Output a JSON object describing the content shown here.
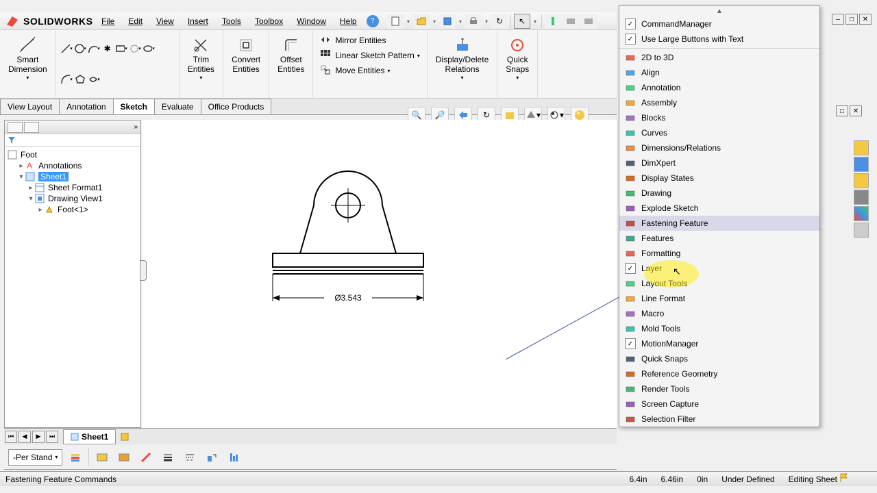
{
  "app": {
    "name": "SOLIDWORKS"
  },
  "menu": [
    "File",
    "Edit",
    "View",
    "Insert",
    "Tools",
    "Toolbox",
    "Window",
    "Help"
  ],
  "ribbon": {
    "smart_dimension": "Smart\nDimension",
    "trim_entities": "Trim\nEntities",
    "convert_entities": "Convert\nEntities",
    "offset_entities": "Offset\nEntities",
    "mirror_entities": "Mirror Entities",
    "linear_pattern": "Linear Sketch Pattern",
    "move_entities": "Move Entities",
    "display_relations": "Display/Delete\nRelations",
    "quick_snaps": "Quick\nSnaps"
  },
  "tabs": [
    "View Layout",
    "Annotation",
    "Sketch",
    "Evaluate",
    "Office Products"
  ],
  "active_tab": "Sketch",
  "tree": {
    "root": "Foot",
    "annotations": "Annotations",
    "sheet": "Sheet1",
    "sheet_format": "Sheet Format1",
    "drawing_view": "Drawing View1",
    "foot_ref": "Foot<1>"
  },
  "dimension": "Ø3.543",
  "sheet_tab": "Sheet1",
  "layer_dropdown": "-Per Stand",
  "status": {
    "message": "Fastening Feature Commands",
    "x": "6.4in",
    "y": "6.46in",
    "z": "0in",
    "defined": "Under Defined",
    "mode": "Editing Sheet"
  },
  "context_menu": {
    "command_manager": "CommandManager",
    "large_buttons": "Use Large Buttons with Text",
    "items": [
      "2D to 3D",
      "Align",
      "Annotation",
      "Assembly",
      "Blocks",
      "Curves",
      "Dimensions/Relations",
      "DimXpert",
      "Display States",
      "Drawing",
      "Explode Sketch",
      "Fastening Feature",
      "Features",
      "Formatting",
      "Layer",
      "Layout Tools",
      "Line Format",
      "Macro",
      "Mold Tools",
      "MotionManager",
      "Quick Snaps",
      "Reference Geometry",
      "Render Tools",
      "Screen Capture",
      "Selection Filter"
    ],
    "checked": [
      "Layer",
      "MotionManager"
    ],
    "highlighted": "Fastening Feature"
  },
  "icon_colors": [
    "#e74c3c",
    "#3498db",
    "#2ecc71",
    "#f39c12",
    "#9b59b6",
    "#1abc9c",
    "#e67e22",
    "#34495e",
    "#d35400",
    "#27ae60",
    "#8e44ad",
    "#c0392b",
    "#16a085"
  ]
}
